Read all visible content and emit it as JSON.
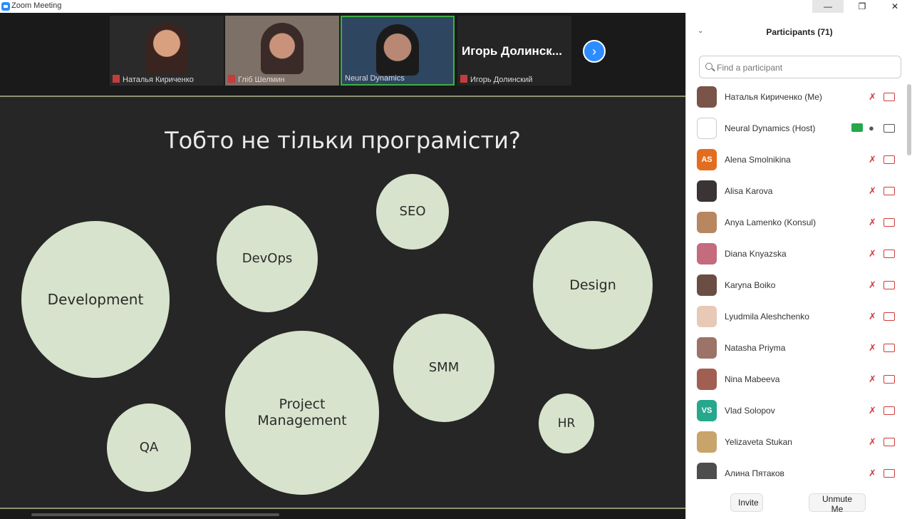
{
  "window": {
    "title": "Zoom Meeting",
    "min_label": "—",
    "max_label": "❐",
    "close_label": "✕"
  },
  "thumbnails": [
    {
      "name": "Наталья Кириченко",
      "muted": true
    },
    {
      "name": "Гліб Шелмин",
      "muted": true
    },
    {
      "name": "Neural Dynamics",
      "muted": false
    },
    {
      "name": "Игорь Долинский",
      "muted": true,
      "big_name": "Игорь Долинск..."
    }
  ],
  "thumb_next_label": "›",
  "slide": {
    "title": "Тобто не тільки програмісти?",
    "bubbles": [
      "Development",
      "DevOps",
      "SEO",
      "Design",
      "SMM",
      "Project Management",
      "QA",
      "HR"
    ]
  },
  "participants": {
    "title": "Participants (71)",
    "collapse_label": "⌄",
    "search_placeholder": "Find a participant",
    "items": [
      {
        "name": "Наталья Кириченко (Me)",
        "initials": "",
        "color": "#7a5448"
      },
      {
        "name": "Neural Dynamics (Host)",
        "initials": "",
        "color": "#ffffff"
      },
      {
        "name": "Alena Smolnikina",
        "initials": "AS",
        "color": "#e36d1e"
      },
      {
        "name": "Alisa Karova",
        "initials": "",
        "color": "#3a3434"
      },
      {
        "name": "Anya Lamenko (Konsul)",
        "initials": "",
        "color": "#b88760"
      },
      {
        "name": "Diana Knyazska",
        "initials": "",
        "color": "#c46b7e"
      },
      {
        "name": "Karyna Boiko",
        "initials": "",
        "color": "#6a4e44"
      },
      {
        "name": "Lyudmila Aleshchenko",
        "initials": "",
        "color": "#e8c9b5"
      },
      {
        "name": "Natasha Priyma",
        "initials": "",
        "color": "#9c7367"
      },
      {
        "name": "Nina Mabeeva",
        "initials": "",
        "color": "#a15f52"
      },
      {
        "name": "Vlad Solopov",
        "initials": "VS",
        "color": "#25a88c"
      },
      {
        "name": "Yelizaveta Stukan",
        "initials": "",
        "color": "#c9a46a"
      },
      {
        "name": "Алина Пятаков",
        "initials": "",
        "color": "#4d4d4d"
      }
    ]
  },
  "footer": {
    "invite_label": "Invite",
    "unmute_label": "Unmute Me"
  }
}
